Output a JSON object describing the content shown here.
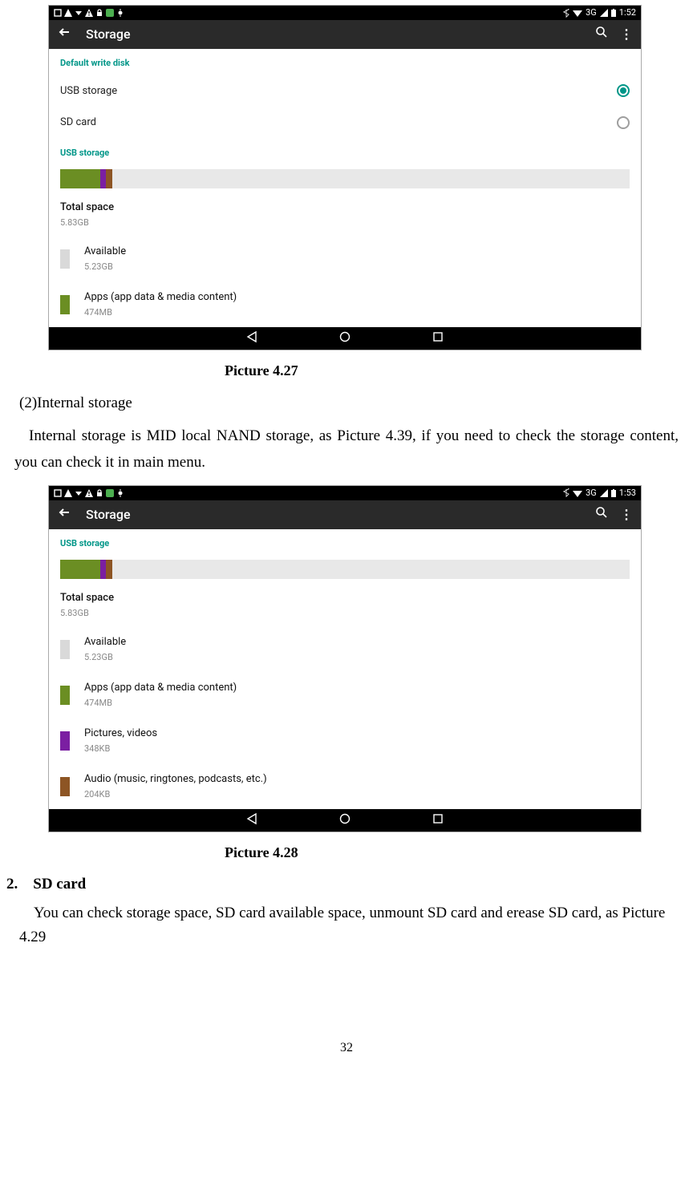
{
  "page_number": "32",
  "fig1": {
    "status": {
      "time": "1:52",
      "net": "3G"
    },
    "appbar_title": "Storage",
    "sec_default": "Default write disk",
    "opt_usb": "USB storage",
    "opt_sd": "SD card",
    "sec_usb": "USB storage",
    "total_lbl": "Total space",
    "total_val": "5.83GB",
    "avail_lbl": "Available",
    "avail_val": "5.23GB",
    "apps_lbl": "Apps (app data & media content)",
    "apps_val": "474MB",
    "caption": "Picture 4.27",
    "segments": [
      {
        "color": "#6b8e23",
        "w": "7%"
      },
      {
        "color": "#7b1fa2",
        "w": "1%"
      },
      {
        "color": "#8d5524",
        "w": "1.2%"
      },
      {
        "color": "#e8e8e8",
        "w": "90.8%"
      }
    ]
  },
  "para1_head": "(2)Internal storage",
  "para1_body": "Internal storage is MID local NAND storage, as Picture 4.39, if you need to check the storage content, you can check it in main menu.",
  "fig2": {
    "status": {
      "time": "1:53",
      "net": "3G"
    },
    "appbar_title": "Storage",
    "sec_usb": "USB storage",
    "total_lbl": "Total space",
    "total_val": "5.83GB",
    "avail_lbl": "Available",
    "avail_val": "5.23GB",
    "apps_lbl": "Apps (app data & media content)",
    "apps_val": "474MB",
    "pics_lbl": "Pictures, videos",
    "pics_val": "348KB",
    "audio_lbl": "Audio (music, ringtones, podcasts, etc.)",
    "audio_val": "204KB",
    "caption": "Picture 4.28",
    "segments": [
      {
        "color": "#6b8e23",
        "w": "7%"
      },
      {
        "color": "#7b1fa2",
        "w": "1%"
      },
      {
        "color": "#8d5524",
        "w": "1.2%"
      },
      {
        "color": "#e8e8e8",
        "w": "90.8%"
      }
    ]
  },
  "heading2": "2. SD card",
  "para2_body": "You can check storage space, SD card available space, unmount SD card and erease SD card, as Picture 4.29",
  "colors": {
    "teal": "#009688",
    "olive": "#6b8e23",
    "purple": "#7b1fa2",
    "brown": "#8d5524",
    "lightgrey": "#e8e8e8",
    "grey_sw": "#d9d9d9"
  }
}
